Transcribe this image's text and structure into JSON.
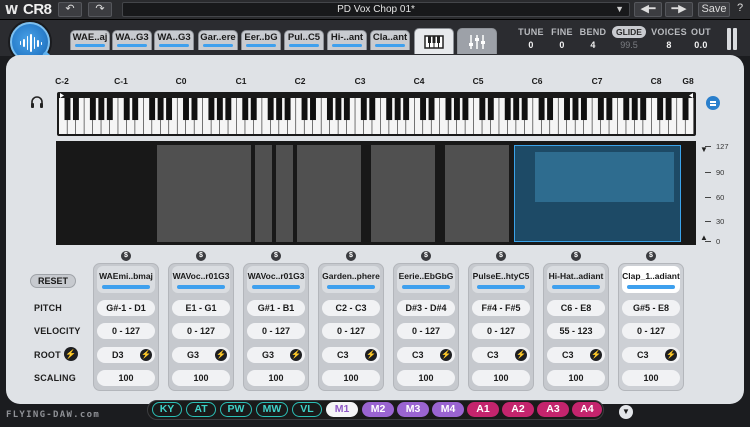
{
  "app": {
    "logo": "CR8",
    "preset_name": "PD Vox Chop 01*",
    "save_label": "Save"
  },
  "tabs": [
    {
      "label": "WAE..aj"
    },
    {
      "label": "WA..G3"
    },
    {
      "label": "WA..G3"
    },
    {
      "label": "Gar..ere"
    },
    {
      "label": "Eer..bG"
    },
    {
      "label": "Pul..C5"
    },
    {
      "label": "Hi-..ant"
    },
    {
      "label": "Cla..ant"
    }
  ],
  "params": {
    "tune": {
      "label": "TUNE",
      "value": "0"
    },
    "fine": {
      "label": "FINE",
      "value": "0"
    },
    "bend": {
      "label": "BEND",
      "value": "4"
    },
    "glide": {
      "label": "GLIDE",
      "value": "99.5"
    },
    "voices": {
      "label": "VOICES",
      "value": "8"
    },
    "out": {
      "label": "OUT",
      "value": "0.0"
    }
  },
  "keyboard_labels": [
    "C-2",
    "C-1",
    "C0",
    "C1",
    "C2",
    "C3",
    "C4",
    "C5",
    "C6",
    "C7",
    "C8",
    "G8"
  ],
  "velocity_axis": [
    "127",
    "90",
    "60",
    "30",
    "0"
  ],
  "row_labels": {
    "reset": "RESET",
    "pitch": "PITCH",
    "velocity": "VELOCITY",
    "root": "ROOT",
    "scaling": "SCALING"
  },
  "columns": [
    {
      "name": "WAEmi..bmaj",
      "pitch_lo": "G#-1",
      "pitch_hi": "D1",
      "vel_lo": "0",
      "vel_hi": "127",
      "root": "D3",
      "scaling": "100"
    },
    {
      "name": "WAVoc..r01G3",
      "pitch_lo": "E1",
      "pitch_hi": "G1",
      "vel_lo": "0",
      "vel_hi": "127",
      "root": "G3",
      "scaling": "100"
    },
    {
      "name": "WAVoc..r01G3",
      "pitch_lo": "G#1",
      "pitch_hi": "B1",
      "vel_lo": "0",
      "vel_hi": "127",
      "root": "G3",
      "scaling": "100"
    },
    {
      "name": "Garden..phere",
      "pitch_lo": "C2",
      "pitch_hi": "C3",
      "vel_lo": "0",
      "vel_hi": "127",
      "root": "C3",
      "scaling": "100"
    },
    {
      "name": "Eerie..EbGbG",
      "pitch_lo": "D#3",
      "pitch_hi": "D#4",
      "vel_lo": "0",
      "vel_hi": "127",
      "root": "C3",
      "scaling": "100"
    },
    {
      "name": "PulseE..htyC5",
      "pitch_lo": "F#4",
      "pitch_hi": "F#5",
      "vel_lo": "0",
      "vel_hi": "127",
      "root": "C3",
      "scaling": "100"
    },
    {
      "name": "Hi-Hat..adiant",
      "pitch_lo": "C6",
      "pitch_hi": "E8",
      "vel_lo": "55",
      "vel_hi": "123",
      "root": "C3",
      "scaling": "100"
    },
    {
      "name": "Clap_1..adiant",
      "pitch_lo": "G#5",
      "pitch_hi": "E8",
      "vel_lo": "0",
      "vel_hi": "127",
      "root": "C3",
      "scaling": "100"
    }
  ],
  "dash": "-",
  "bottom": {
    "brand": "FLYING-DAW.com",
    "pills": [
      "KY",
      "AT",
      "PW",
      "MW",
      "VL",
      "M1",
      "M2",
      "M3",
      "M4",
      "A1",
      "A2",
      "A3",
      "A4"
    ]
  }
}
